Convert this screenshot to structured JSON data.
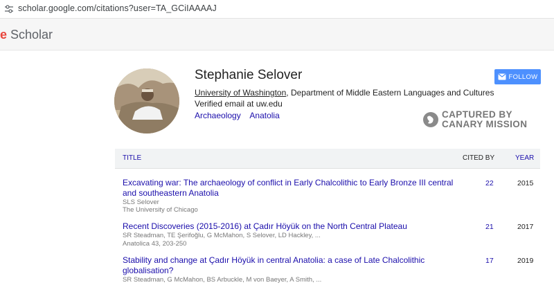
{
  "browser": {
    "url": "scholar.google.com/citations?user=TA_GCiIAAAAJ"
  },
  "header": {
    "logo_accent": "e",
    "logo_text": " Scholar"
  },
  "profile": {
    "name": "Stephanie Selover",
    "affiliation_link": "University of Washington",
    "affiliation_rest": ", Department of Middle Eastern Languages and Cultures",
    "email": "Verified email at uw.edu",
    "interests": [
      "Archaeology",
      "Anatolia"
    ],
    "follow_label": "FOLLOW"
  },
  "watermark": {
    "line1": "CAPTURED BY",
    "line2": "CANARY MISSION"
  },
  "table": {
    "headers": {
      "title": "TITLE",
      "cited_by": "CITED BY",
      "year": "YEAR"
    },
    "rows": [
      {
        "title": "Excavating war: The archaeology of conflict in Early Chalcolithic to Early Bronze III central and southeastern Anatolia",
        "authors": "SLS Selover",
        "venue": "The University of Chicago",
        "cited_by": "22",
        "year": "2015"
      },
      {
        "title": "Recent Discoveries (2015-2016) at Çadır Höyük on the North Central Plateau",
        "authors": "SR Steadman, TE Şerifoğlu, G McMahon, S Selover, LD Hackley, ...",
        "venue": "Anatolica 43, 203-250",
        "cited_by": "21",
        "year": "2017"
      },
      {
        "title": "Stability and change at Çadır Höyük in central Anatolia: a case of Late Chalcolithic globalisation?",
        "authors": "SR Steadman, G McMahon, BS Arbuckle, M von Baeyer, A Smith, ...",
        "venue": "",
        "cited_by": "17",
        "year": "2019"
      }
    ]
  },
  "colors": {
    "link": "#1a0dab",
    "follow_button": "#4d90fe",
    "logo_accent": "#e8453c"
  }
}
